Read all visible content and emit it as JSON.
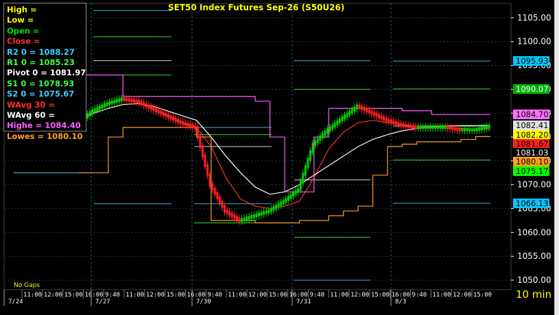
{
  "title": "SET50  Index  Futures  Sep-26  (S50U26)",
  "legend": [
    {
      "text": "High  =",
      "color": "#ffff00"
    },
    {
      "text": "Low  =",
      "color": "#ffff00"
    },
    {
      "text": "Open  =",
      "color": "#00e000"
    },
    {
      "text": "Close  =",
      "color": "#ff3030"
    },
    {
      "text": "R2  0  =  1088.27",
      "color": "#40d0ff"
    },
    {
      "text": "R1  0  =  1085.23",
      "color": "#40ff40"
    },
    {
      "text": "Pivot  0  =  1081.97",
      "color": "#ffffff"
    },
    {
      "text": "S1  0  =  1078.93",
      "color": "#40ff40"
    },
    {
      "text": "S2  0  =  1075.67",
      "color": "#40d0ff"
    },
    {
      "text": "WAvg  30  =",
      "color": "#ff3030"
    },
    {
      "text": "WAvg  60  =",
      "color": "#ffffff"
    },
    {
      "text": "Highe  =  1084.40",
      "color": "#ff60ff"
    },
    {
      "text": "Lowes  =  1080.10",
      "color": "#ffa020"
    }
  ],
  "price_axis": {
    "min": 1048,
    "max": 1108,
    "ticks": [
      "1105.00",
      "1100.00",
      "1095.00",
      "1090.00",
      "1085.00",
      "1080.00",
      "1075.00",
      "1070.00",
      "1065.00",
      "1060.00",
      "1055.00",
      "1050.00"
    ]
  },
  "price_tags": [
    {
      "label": "1095.93",
      "value": 1095.93,
      "bg": "#00c8ff",
      "fg": "#000000"
    },
    {
      "label": "1090.07",
      "value": 1090.07,
      "bg": "#00b000",
      "fg": "#ffffff"
    },
    {
      "label": "1084.70",
      "value": 1084.7,
      "bg": "#ff70ff",
      "fg": "#000000"
    },
    {
      "label": "1082.41",
      "value": 1082.41,
      "bg": "#e0e0e0",
      "fg": "#000000"
    },
    {
      "label": "1082.20",
      "value": 1082.2,
      "bg": "#ffff00",
      "fg": "#000000"
    },
    {
      "label": "1081.67",
      "value": 1081.67,
      "bg": "#ff2020",
      "fg": "#000000"
    },
    {
      "label": "1081.03",
      "value": 1081.03,
      "bg": "#000000",
      "fg": "#ffffff"
    },
    {
      "label": "1080.10",
      "value": 1080.1,
      "bg": "#ffa020",
      "fg": "#000000"
    },
    {
      "label": "1075.17",
      "value": 1075.17,
      "bg": "#00ff00",
      "fg": "#000000"
    },
    {
      "label": "1066.13",
      "value": 1066.13,
      "bg": "#00c8ff",
      "fg": "#000000"
    }
  ],
  "time_axis": {
    "row1": [
      "11:00",
      "12:00",
      "15:00",
      "16:00",
      "9:40",
      "11:00",
      "12:00",
      "15:00",
      "16:00",
      "9:40",
      "11:00",
      "12:00",
      "15:00",
      "16:00",
      "9:40",
      "11:00",
      "12:00",
      "15:00",
      "16:00",
      "9:40",
      "11:00",
      "12:00",
      "15:00"
    ],
    "dates": [
      "7/24",
      "7/27",
      "7/30",
      "7/31",
      "8/3"
    ]
  },
  "footer": {
    "no_gaps": "No  Gaps",
    "interval": "10  min"
  },
  "colors": {
    "grid": "#1a3a4a",
    "session_divider": "#1a5a7a",
    "r2_s2": "#40d0ff",
    "r1_s1": "#40ff40",
    "pivot": "#ffffff",
    "wavg30": "#ff3030",
    "wavg60": "#ffffff",
    "highest": "#ff60ff",
    "lowest": "#ffa020",
    "candle_up": "#00d000",
    "candle_down": "#ff2020"
  },
  "chart_data": {
    "type": "line",
    "title": "SET50  Index  Futures  Sep-26  (S50U26)",
    "interval": "10  min",
    "ylim": [
      1048,
      1108
    ],
    "x_dates": [
      "7/24",
      "7/27",
      "7/30",
      "7/31",
      "8/3"
    ],
    "series": [
      {
        "name": "Close",
        "values": [
          1083.0,
          1085.5,
          1087.0,
          1088.0,
          1087.5,
          1086.0,
          1084.5,
          1083.0,
          1082.0,
          1070.0,
          1064.5,
          1062.5,
          1063.5,
          1064.5,
          1066.5,
          1069.0,
          1078.5,
          1081.5,
          1084.0,
          1086.5,
          1085.0,
          1083.5,
          1082.5,
          1082.0,
          1082.0,
          1082.0,
          1081.5,
          1081.5,
          1082.2
        ]
      },
      {
        "name": "WAvg  30",
        "values": [
          1083.0,
          1085.0,
          1087.0,
          1087.8,
          1087.2,
          1086.0,
          1084.5,
          1083.0,
          1082.0,
          1078.0,
          1071.5,
          1067.0,
          1065.5,
          1065.0,
          1065.5,
          1066.5,
          1071.5,
          1077.5,
          1081.0,
          1083.0,
          1083.5,
          1083.0,
          1082.6,
          1082.3,
          1082.0,
          1081.9,
          1081.8,
          1081.7,
          1081.67
        ]
      },
      {
        "name": "WAvg  60",
        "values": [
          1084.0,
          1085.0,
          1086.0,
          1086.8,
          1087.0,
          1086.5,
          1085.5,
          1084.5,
          1083.5,
          1080.0,
          1076.0,
          1072.5,
          1069.5,
          1068.0,
          1068.5,
          1070.0,
          1072.0,
          1074.0,
          1076.0,
          1078.0,
          1079.5,
          1080.5,
          1081.3,
          1081.8,
          1082.1,
          1082.3,
          1082.4,
          1082.4,
          1082.41
        ]
      },
      {
        "name": "Highe",
        "values": [
          1093.0,
          1093.0,
          1093.0,
          1088.5,
          1088.5,
          1088.5,
          1088.5,
          1088.5,
          1088.5,
          1088.5,
          1088.5,
          1088.5,
          1087.5,
          1080.0,
          1068.5,
          1068.5,
          1080.0,
          1086.0,
          1086.0,
          1086.0,
          1086.0,
          1086.0,
          1085.5,
          1085.5,
          1084.7,
          1084.7,
          1084.7,
          1084.7,
          1084.7
        ]
      },
      {
        "name": "Lowes",
        "values": [
          1072.5,
          1072.5,
          1080.0,
          1082.0,
          1082.0,
          1082.0,
          1082.0,
          1082.0,
          1080.0,
          1062.5,
          1062.5,
          1062.5,
          1062.0,
          1062.0,
          1062.0,
          1062.5,
          1062.5,
          1063.5,
          1064.5,
          1065.5,
          1072.0,
          1078.0,
          1078.5,
          1079.0,
          1079.0,
          1079.0,
          1079.5,
          1080.1,
          1080.1
        ]
      }
    ],
    "pivot_levels": [
      {
        "name": "R2",
        "value": 1088.27
      },
      {
        "name": "R1",
        "value": 1085.23
      },
      {
        "name": "Pivot",
        "value": 1081.97
      },
      {
        "name": "S1",
        "value": 1078.93
      },
      {
        "name": "S2",
        "value": 1075.67
      }
    ]
  }
}
